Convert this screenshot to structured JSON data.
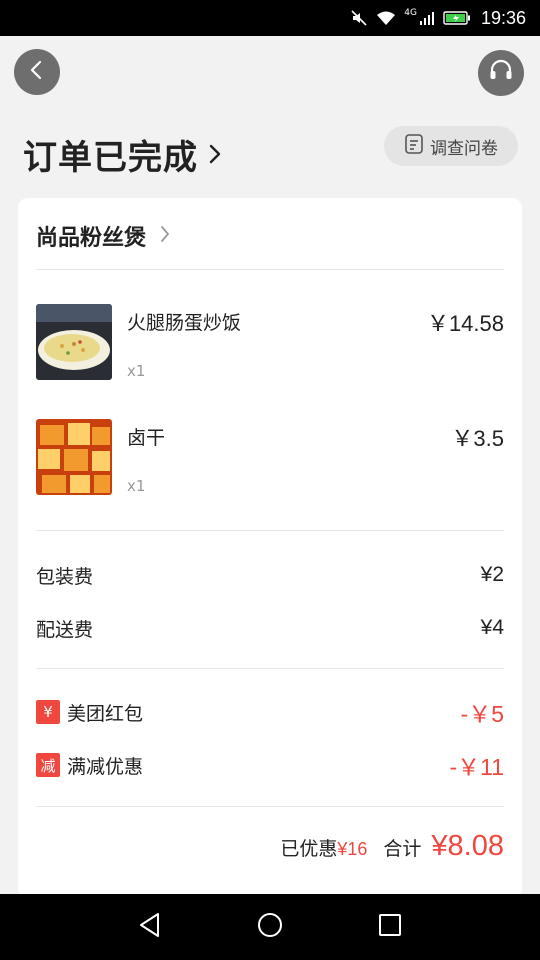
{
  "status_bar": {
    "time": "19:36",
    "network": "4G"
  },
  "header": {
    "back_icon": "chevron-left-icon",
    "service_icon": "headset-icon",
    "title": "订单已完成",
    "survey_label": "调查问卷"
  },
  "shop": {
    "name": "尚品粉丝煲"
  },
  "items": [
    {
      "name": "火腿肠蛋炒饭",
      "qty": "x1",
      "price": "￥14.58",
      "thumb_colors": [
        "#2a2d34",
        "#e9d98a",
        "#f4f0e0"
      ]
    },
    {
      "name": "卤干",
      "qty": "x1",
      "price": "￥3.5",
      "thumb_colors": [
        "#c9400f",
        "#f29a2e",
        "#ffd06a"
      ]
    }
  ],
  "fees": [
    {
      "label": "包装费",
      "amount": "¥2"
    },
    {
      "label": "配送费",
      "amount": "¥4"
    }
  ],
  "discounts": [
    {
      "badge": "¥",
      "label": "美团红包",
      "amount": "-￥5"
    },
    {
      "badge": "减",
      "label": "满减优惠",
      "amount": "-￥11"
    }
  ],
  "summary": {
    "saved_label": "已优惠",
    "saved_amount": "¥16",
    "total_label": "合计",
    "total_amount": "¥8.08"
  },
  "colors": {
    "accent": "#f0473e",
    "background": "#f2f2f2",
    "card": "#ffffff"
  }
}
